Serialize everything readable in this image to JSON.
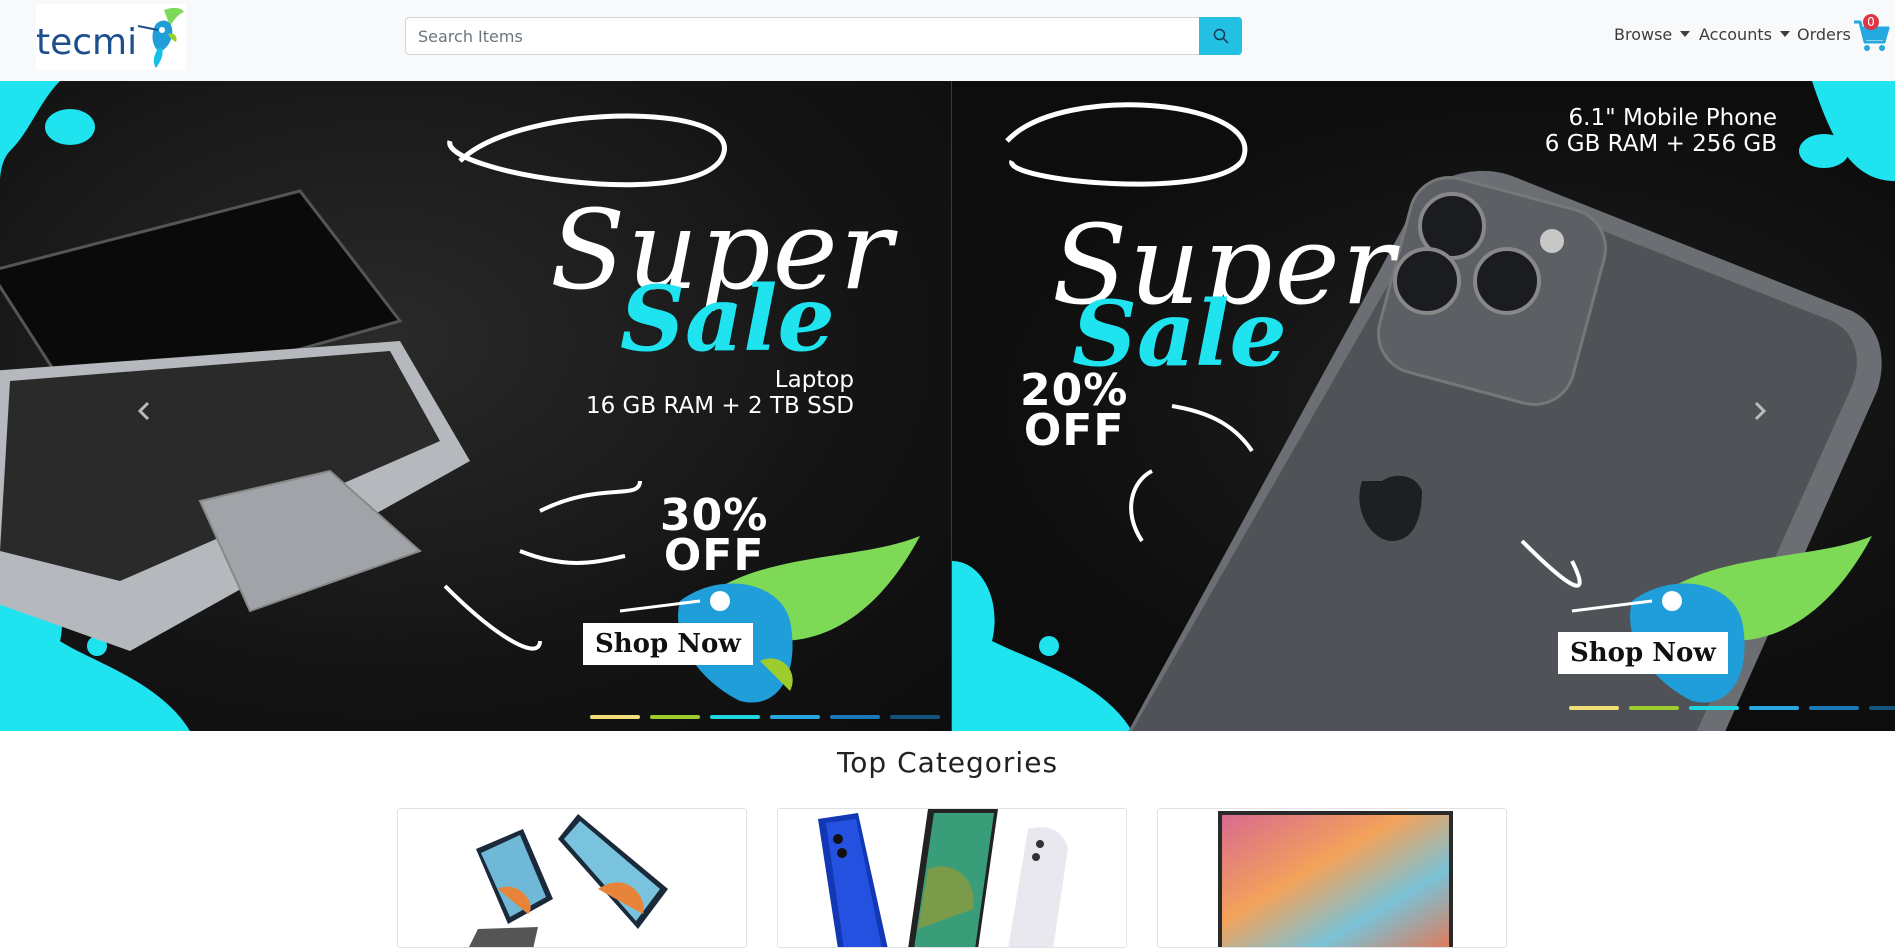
{
  "brand": {
    "name": "tecmi"
  },
  "search": {
    "placeholder": "Search Items",
    "value": ""
  },
  "nav": {
    "browse": "Browse",
    "accounts": "Accounts",
    "orders": "Orders",
    "cart_count": "0"
  },
  "carousel": {
    "slides": [
      {
        "headline_1": "Super",
        "headline_2": "Sale",
        "product": "Laptop",
        "spec": "16 GB RAM + 2 TB SSD",
        "discount_pct": "30%",
        "discount_word": "OFF",
        "cta": "Shop Now"
      },
      {
        "headline_1": "Super",
        "headline_2": "Sale",
        "product": "6.1\"  Mobile Phone",
        "spec": "6 GB RAM + 256 GB",
        "discount_pct": "20%",
        "discount_word": "OFF",
        "cta": "Shop Now"
      }
    ],
    "indicator_colors": [
      "#f3df7a",
      "#9ccd2c",
      "#1fd7e0",
      "#28a6e0",
      "#1a78b7",
      "#14537e"
    ],
    "accent": "#1fe4f0"
  },
  "categories": {
    "title": "Top Categories"
  },
  "colors": {
    "search_button": "#23c0e3",
    "badge": "#dc3545",
    "cart": "#23a8e0"
  }
}
